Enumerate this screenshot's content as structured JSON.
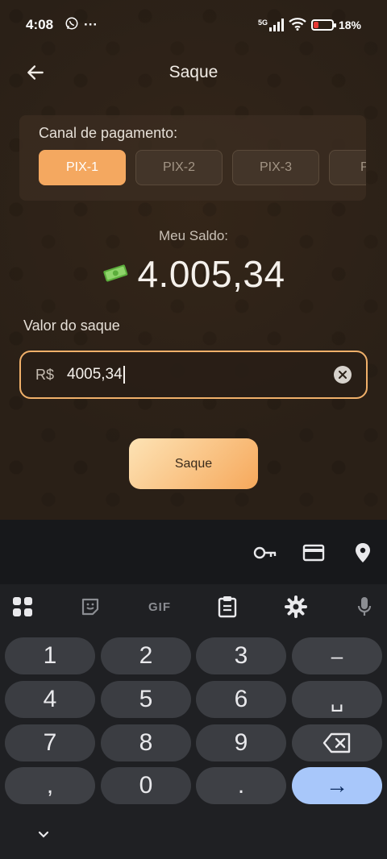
{
  "status_bar": {
    "time": "4:08",
    "overflow": "···",
    "network": "5G",
    "battery_percent": "18%",
    "battery_level": 0.18
  },
  "header": {
    "title": "Saque"
  },
  "channel": {
    "label": "Canal de pagamento:",
    "options": [
      "PIX-1",
      "PIX-2",
      "PIX-3",
      "P"
    ],
    "selected": "PIX-1"
  },
  "balance": {
    "label": "Meu Saldo:",
    "value": "4.005,34"
  },
  "amount": {
    "label": "Valor do saque",
    "currency": "R$",
    "value": "4005,34"
  },
  "submit": {
    "label": "Saque"
  },
  "keyboard": {
    "toolbar": {
      "gif_label": "GIF"
    },
    "keys": [
      {
        "label": "1",
        "name": "key-1"
      },
      {
        "label": "2",
        "name": "key-2"
      },
      {
        "label": "3",
        "name": "key-3"
      },
      {
        "label": "–",
        "name": "key-minus"
      },
      {
        "label": "4",
        "name": "key-4"
      },
      {
        "label": "5",
        "name": "key-5"
      },
      {
        "label": "6",
        "name": "key-6"
      },
      {
        "label": "␣",
        "name": "key-space"
      },
      {
        "label": "7",
        "name": "key-7"
      },
      {
        "label": "8",
        "name": "key-8"
      },
      {
        "label": "9",
        "name": "key-9"
      },
      {
        "label": "",
        "name": "key-backspace"
      },
      {
        "label": ",",
        "name": "key-comma"
      },
      {
        "label": "0",
        "name": "key-0"
      },
      {
        "label": ".",
        "name": "key-period"
      },
      {
        "label": "→",
        "name": "key-enter"
      }
    ]
  },
  "colors": {
    "accent": "#f4a860",
    "background": "#2a2017",
    "keyboard_bg": "#1f2023",
    "enter_key": "#a8c7fa"
  }
}
